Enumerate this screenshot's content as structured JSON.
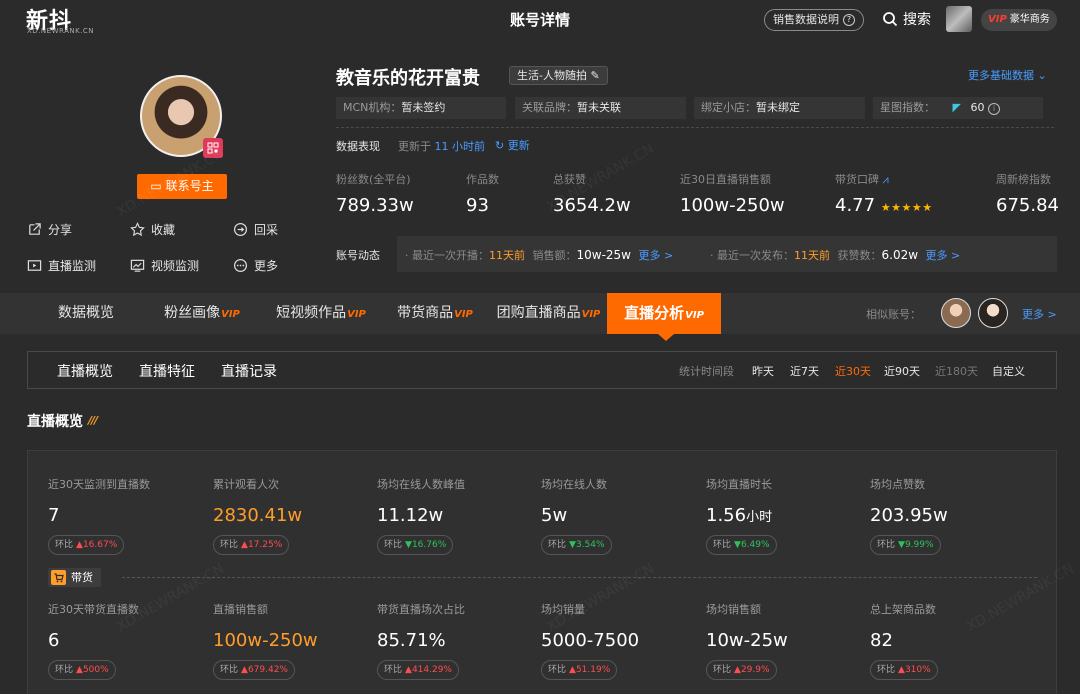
{
  "brand": {
    "logo": "新抖",
    "logo_sub": "XD.NEWRANK.CN"
  },
  "header": {
    "title": "账号详情",
    "sales_help": "销售数据说明",
    "search": "搜索",
    "vip_mark": "VIP",
    "vip_label": "豪华商务"
  },
  "profile": {
    "contact": "联系号主",
    "actions": [
      "分享",
      "收藏",
      "回采",
      "直播监测",
      "视频监测",
      "更多"
    ],
    "name": "教音乐的花开富贵",
    "category": "生活-人物随拍",
    "more_basic": "更多基础数据",
    "info": [
      {
        "label": "MCN机构：",
        "value": "暂未签约"
      },
      {
        "label": "关联品牌：",
        "value": "暂未关联"
      },
      {
        "label": "绑定小店：",
        "value": "暂未绑定"
      },
      {
        "label": "星图指数：",
        "value": "60"
      }
    ]
  },
  "performance": {
    "label": "数据表现",
    "update_prefix": "更新于",
    "update_time": "11 小时前",
    "refresh": "更新",
    "stats": [
      {
        "label": "粉丝数(全平台)",
        "value": "789.33w"
      },
      {
        "label": "作品数",
        "value": "93"
      },
      {
        "label": "总获赞",
        "value": "3654.2w"
      },
      {
        "label": "近30日直播销售额",
        "value": "100w-250w"
      },
      {
        "label": "带货口碑",
        "value": "4.77",
        "stars": "★★★★★"
      },
      {
        "label": "周新榜指数",
        "value": "675.84"
      }
    ]
  },
  "dynamics": {
    "label": "账号动态",
    "live_prefix": "· 最近一次开播：",
    "live_time": "11天前",
    "live_sales_label": "销售额：",
    "live_sales": "10w-25w",
    "live_more": "更多 >",
    "pub_prefix": "· 最近一次发布：",
    "pub_time": "11天前",
    "pub_likes_label": "获赞数：",
    "pub_likes": "6.02w",
    "pub_more": "更多 >"
  },
  "tabs": [
    {
      "label": "数据概览",
      "vip": ""
    },
    {
      "label": "粉丝画像",
      "vip": "VIP"
    },
    {
      "label": "短视频作品",
      "vip": "VIP"
    },
    {
      "label": "带货商品",
      "vip": "VIP"
    },
    {
      "label": "团购直播商品",
      "vip": "VIP"
    },
    {
      "label": "直播分析",
      "vip": "VIP"
    }
  ],
  "similar": {
    "label": "相似账号：",
    "more": "更多 >"
  },
  "subtabs": [
    "直播概览",
    "直播特征",
    "直播记录"
  ],
  "periods": {
    "label": "统计时间段",
    "items": [
      "昨天",
      "近7天",
      "近30天",
      "近90天",
      "近180天",
      "自定义"
    ]
  },
  "overview": {
    "title": "直播概览",
    "deco": "///",
    "ratio_label": "环比",
    "cargo_label": "带货",
    "row1": [
      {
        "label": "近30天监测到直播数",
        "value": "7",
        "ratio": "16.67%",
        "dir": "▲"
      },
      {
        "label": "累计观看人次",
        "value": "2830.41w",
        "ratio": "17.25%",
        "dir": "▲"
      },
      {
        "label": "场均在线人数峰值",
        "value": "11.12w",
        "ratio": "16.76%",
        "dir": "▼"
      },
      {
        "label": "场均在线人数",
        "value": "5w",
        "ratio": "3.54%",
        "dir": "▼"
      },
      {
        "label": "场均直播时长",
        "value": "1.56",
        "unit": "小时",
        "ratio": "6.49%",
        "dir": "▼"
      },
      {
        "label": "场均点赞数",
        "value": "203.95w",
        "ratio": "9.99%",
        "dir": "▼"
      }
    ],
    "row2": [
      {
        "label": "近30天带货直播数",
        "value": "6",
        "ratio": "500%",
        "dir": "▲"
      },
      {
        "label": "直播销售额",
        "value": "100w-250w",
        "ratio": "679.42%",
        "dir": "▲"
      },
      {
        "label": "带货直播场次占比",
        "value": "85.71%",
        "ratio": "414.29%",
        "dir": "▲"
      },
      {
        "label": "场均销量",
        "value": "5000-7500",
        "ratio": "51.19%",
        "dir": "▲"
      },
      {
        "label": "场均销售额",
        "value": "10w-25w",
        "ratio": "29.9%",
        "dir": "▲"
      },
      {
        "label": "总上架商品数",
        "value": "82",
        "ratio": "310%",
        "dir": "▲"
      }
    ]
  },
  "colors": {
    "accent": "#ff6a00",
    "up": "#ff4d4f",
    "down": "#2fc25b",
    "link": "#4a9cff",
    "bg": "#2b2b2b"
  }
}
